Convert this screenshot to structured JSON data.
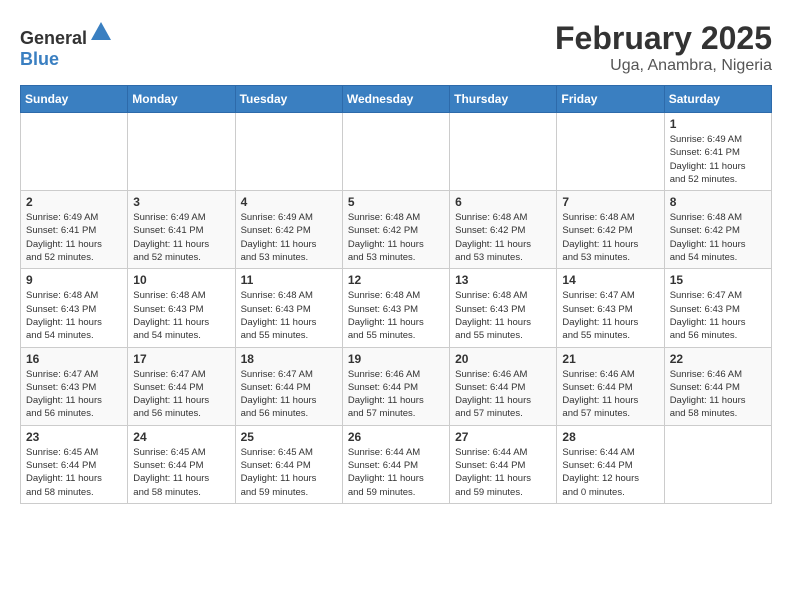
{
  "logo": {
    "general": "General",
    "blue": "Blue"
  },
  "title": "February 2025",
  "location": "Uga, Anambra, Nigeria",
  "days_of_week": [
    "Sunday",
    "Monday",
    "Tuesday",
    "Wednesday",
    "Thursday",
    "Friday",
    "Saturday"
  ],
  "weeks": [
    [
      {
        "day": "",
        "info": ""
      },
      {
        "day": "",
        "info": ""
      },
      {
        "day": "",
        "info": ""
      },
      {
        "day": "",
        "info": ""
      },
      {
        "day": "",
        "info": ""
      },
      {
        "day": "",
        "info": ""
      },
      {
        "day": "1",
        "info": "Sunrise: 6:49 AM\nSunset: 6:41 PM\nDaylight: 11 hours\nand 52 minutes."
      }
    ],
    [
      {
        "day": "2",
        "info": "Sunrise: 6:49 AM\nSunset: 6:41 PM\nDaylight: 11 hours\nand 52 minutes."
      },
      {
        "day": "3",
        "info": "Sunrise: 6:49 AM\nSunset: 6:41 PM\nDaylight: 11 hours\nand 52 minutes."
      },
      {
        "day": "4",
        "info": "Sunrise: 6:49 AM\nSunset: 6:42 PM\nDaylight: 11 hours\nand 53 minutes."
      },
      {
        "day": "5",
        "info": "Sunrise: 6:48 AM\nSunset: 6:42 PM\nDaylight: 11 hours\nand 53 minutes."
      },
      {
        "day": "6",
        "info": "Sunrise: 6:48 AM\nSunset: 6:42 PM\nDaylight: 11 hours\nand 53 minutes."
      },
      {
        "day": "7",
        "info": "Sunrise: 6:48 AM\nSunset: 6:42 PM\nDaylight: 11 hours\nand 53 minutes."
      },
      {
        "day": "8",
        "info": "Sunrise: 6:48 AM\nSunset: 6:42 PM\nDaylight: 11 hours\nand 54 minutes."
      }
    ],
    [
      {
        "day": "9",
        "info": "Sunrise: 6:48 AM\nSunset: 6:43 PM\nDaylight: 11 hours\nand 54 minutes."
      },
      {
        "day": "10",
        "info": "Sunrise: 6:48 AM\nSunset: 6:43 PM\nDaylight: 11 hours\nand 54 minutes."
      },
      {
        "day": "11",
        "info": "Sunrise: 6:48 AM\nSunset: 6:43 PM\nDaylight: 11 hours\nand 55 minutes."
      },
      {
        "day": "12",
        "info": "Sunrise: 6:48 AM\nSunset: 6:43 PM\nDaylight: 11 hours\nand 55 minutes."
      },
      {
        "day": "13",
        "info": "Sunrise: 6:48 AM\nSunset: 6:43 PM\nDaylight: 11 hours\nand 55 minutes."
      },
      {
        "day": "14",
        "info": "Sunrise: 6:47 AM\nSunset: 6:43 PM\nDaylight: 11 hours\nand 55 minutes."
      },
      {
        "day": "15",
        "info": "Sunrise: 6:47 AM\nSunset: 6:43 PM\nDaylight: 11 hours\nand 56 minutes."
      }
    ],
    [
      {
        "day": "16",
        "info": "Sunrise: 6:47 AM\nSunset: 6:43 PM\nDaylight: 11 hours\nand 56 minutes."
      },
      {
        "day": "17",
        "info": "Sunrise: 6:47 AM\nSunset: 6:44 PM\nDaylight: 11 hours\nand 56 minutes."
      },
      {
        "day": "18",
        "info": "Sunrise: 6:47 AM\nSunset: 6:44 PM\nDaylight: 11 hours\nand 56 minutes."
      },
      {
        "day": "19",
        "info": "Sunrise: 6:46 AM\nSunset: 6:44 PM\nDaylight: 11 hours\nand 57 minutes."
      },
      {
        "day": "20",
        "info": "Sunrise: 6:46 AM\nSunset: 6:44 PM\nDaylight: 11 hours\nand 57 minutes."
      },
      {
        "day": "21",
        "info": "Sunrise: 6:46 AM\nSunset: 6:44 PM\nDaylight: 11 hours\nand 57 minutes."
      },
      {
        "day": "22",
        "info": "Sunrise: 6:46 AM\nSunset: 6:44 PM\nDaylight: 11 hours\nand 58 minutes."
      }
    ],
    [
      {
        "day": "23",
        "info": "Sunrise: 6:45 AM\nSunset: 6:44 PM\nDaylight: 11 hours\nand 58 minutes."
      },
      {
        "day": "24",
        "info": "Sunrise: 6:45 AM\nSunset: 6:44 PM\nDaylight: 11 hours\nand 58 minutes."
      },
      {
        "day": "25",
        "info": "Sunrise: 6:45 AM\nSunset: 6:44 PM\nDaylight: 11 hours\nand 59 minutes."
      },
      {
        "day": "26",
        "info": "Sunrise: 6:44 AM\nSunset: 6:44 PM\nDaylight: 11 hours\nand 59 minutes."
      },
      {
        "day": "27",
        "info": "Sunrise: 6:44 AM\nSunset: 6:44 PM\nDaylight: 11 hours\nand 59 minutes."
      },
      {
        "day": "28",
        "info": "Sunrise: 6:44 AM\nSunset: 6:44 PM\nDaylight: 12 hours\nand 0 minutes."
      },
      {
        "day": "",
        "info": ""
      }
    ]
  ]
}
